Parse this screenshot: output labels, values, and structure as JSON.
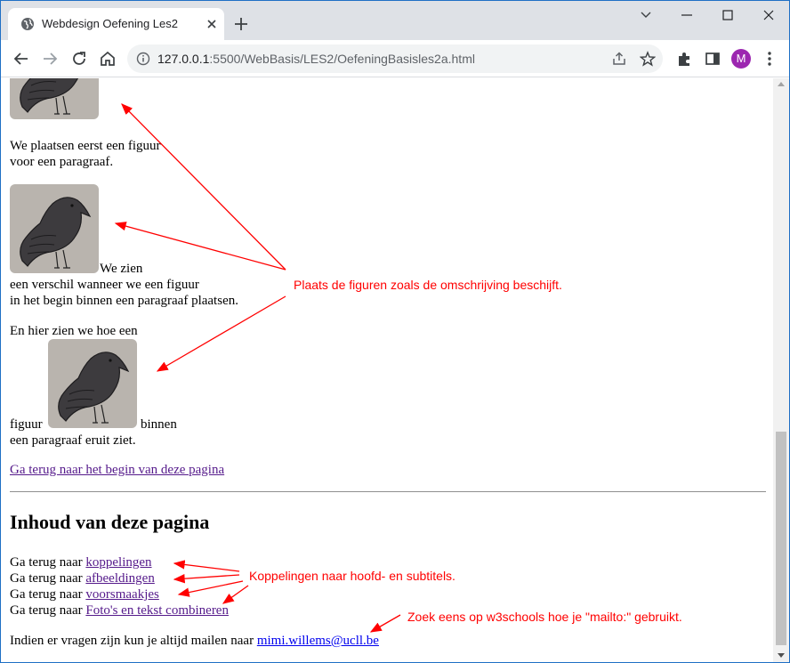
{
  "browser": {
    "tab_title": "Webdesign Oefening Les2",
    "url_host": "127.0.0.1",
    "url_path": ":5500/WebBasis/LES2/OefeningBasisles2a.html",
    "profile_initial": "M"
  },
  "page": {
    "para1_line1": "We plaatsen eerst een figuur",
    "para1_line2": "voor een paragraaf.",
    "para2_line1": "We zien",
    "para2_line2": "een verschil wanneer we een figuur",
    "para2_line3": "in het begin binnen een paragraaf plaatsen.",
    "para3_line1": "En hier zien we hoe een",
    "para3_before": "figuur",
    "para3_after": "binnen",
    "para3_line3": "een paragraaf eruit ziet.",
    "back_to_top": "Ga terug naar het begin van deze pagina",
    "toc_heading": "Inhoud van deze pagina",
    "toc_prefix": "Ga terug naar",
    "toc_items": [
      "koppelingen",
      "afbeeldingen",
      "voorsmaakjes",
      "Foto's en tekst combineren"
    ],
    "contact_text": "Indien er vragen zijn kun je altijd mailen naar",
    "contact_email": "mimi.willems@ucll.be"
  },
  "annotations": {
    "figures_note": "Plaats de figuren zoals de omschrijving beschijft.",
    "links_note": "Koppelingen naar hoofd- en subtitels.",
    "mailto_note": "Zoek eens op w3schools hoe je \"mailto:\" gebruikt.",
    "color": "#ff0000"
  }
}
